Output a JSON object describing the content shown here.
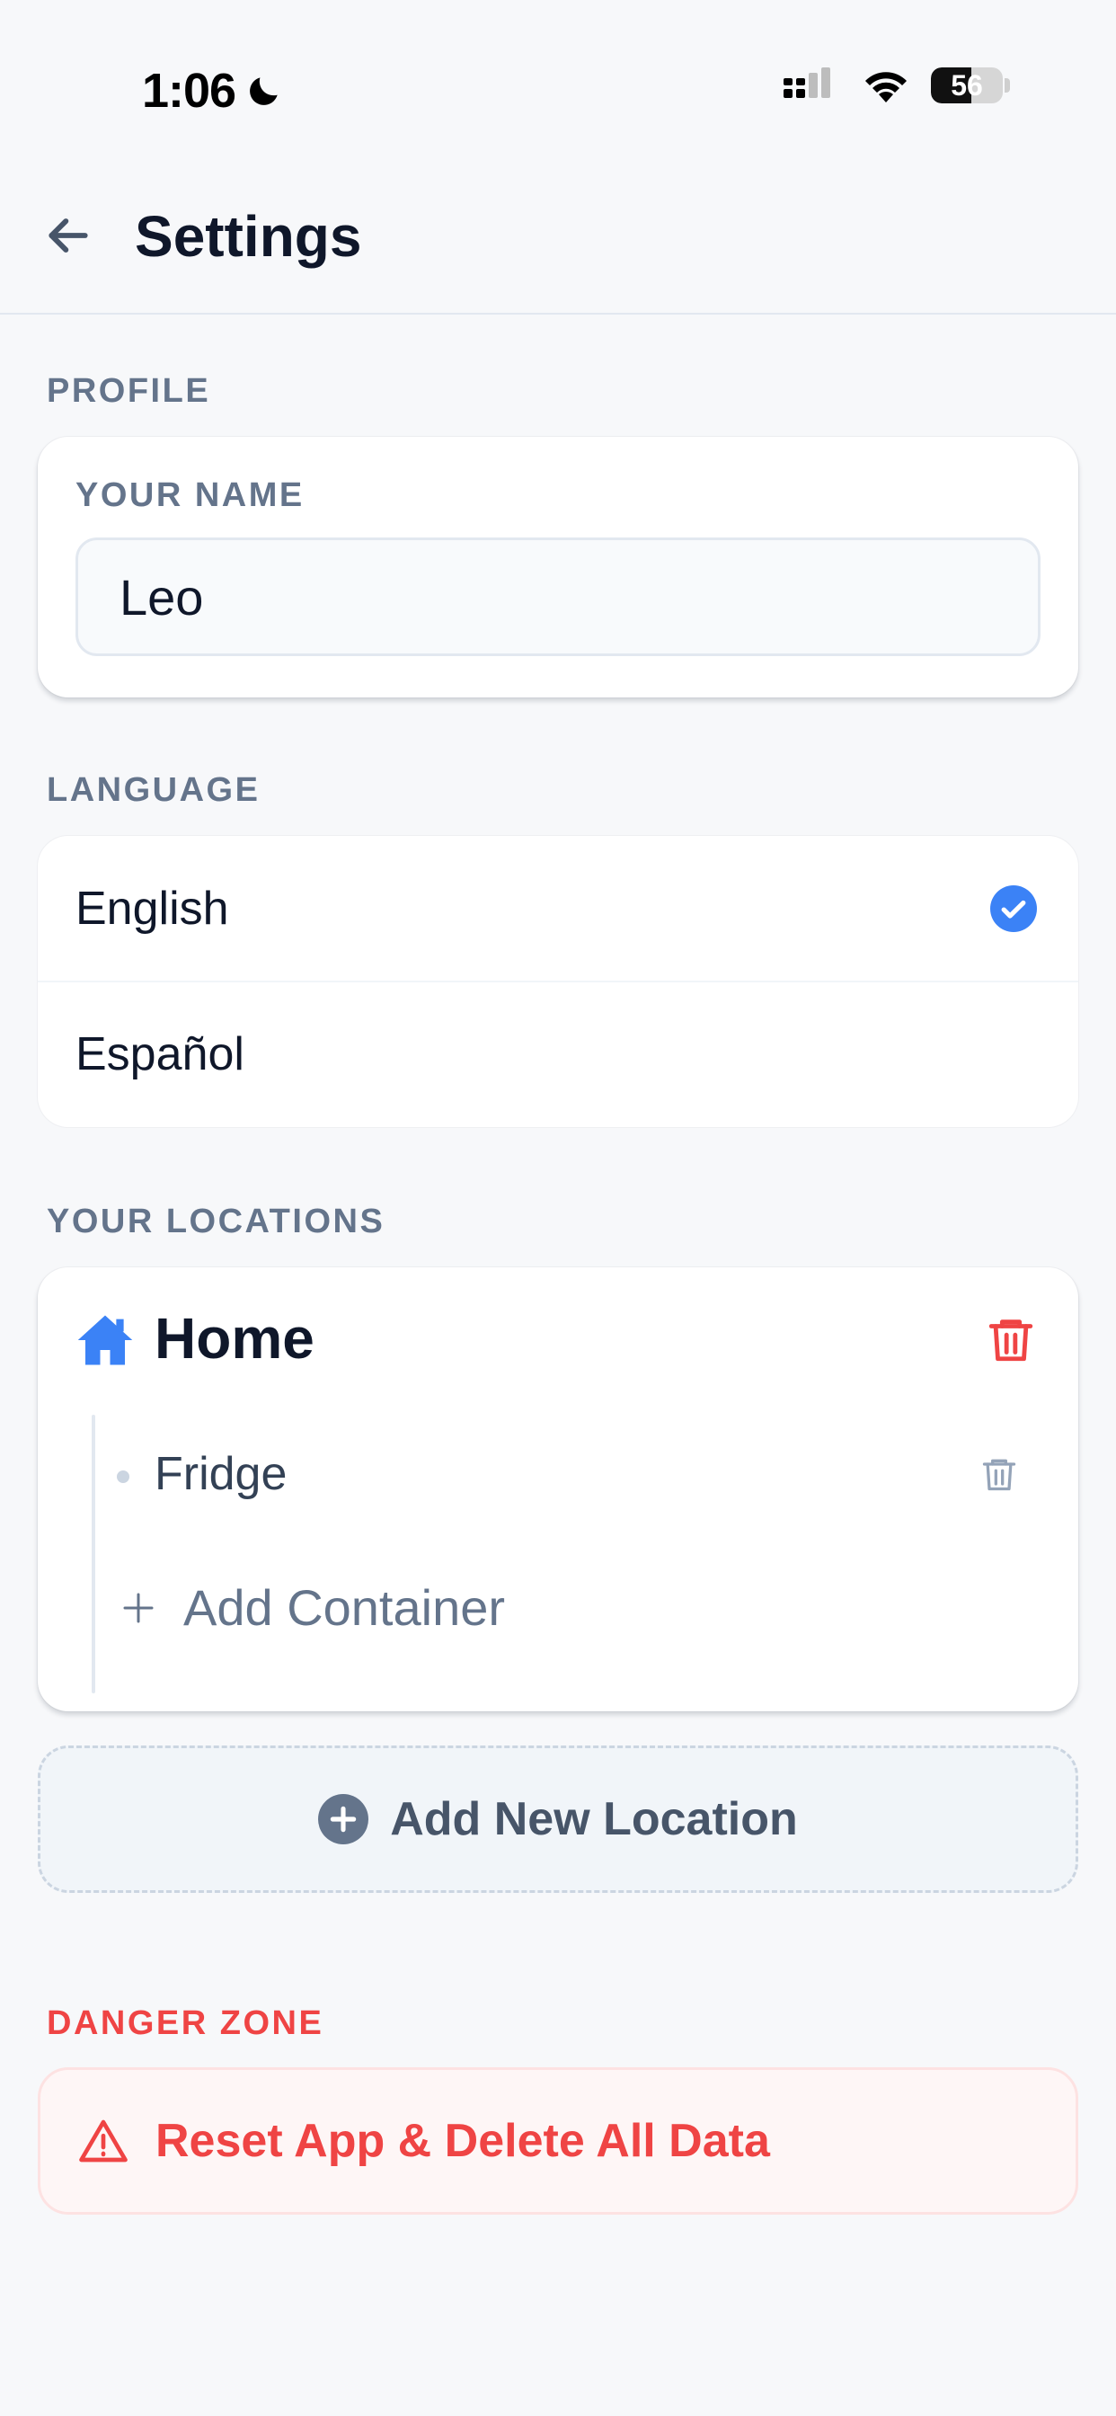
{
  "status_bar": {
    "time": "1:06",
    "battery": "56",
    "battery_level": 0.56
  },
  "header": {
    "title": "Settings"
  },
  "profile": {
    "section_label": "PROFILE",
    "name_label": "YOUR NAME",
    "name_value": "Leo"
  },
  "language": {
    "section_label": "LANGUAGE",
    "options": [
      {
        "label": "English",
        "selected": true
      },
      {
        "label": "Español",
        "selected": false
      }
    ]
  },
  "locations": {
    "section_label": "YOUR LOCATIONS",
    "items": [
      {
        "name": "Home",
        "icon": "home-icon",
        "containers": [
          "Fridge"
        ]
      }
    ],
    "add_container_label": "Add Container",
    "add_location_label": "Add New Location"
  },
  "danger_zone": {
    "section_label": "DANGER ZONE",
    "reset_label": "Reset App & Delete All Data"
  },
  "colors": {
    "accent": "#3b82f6",
    "danger": "#ef4444",
    "text_primary": "#0f172a",
    "text_muted": "#64748b",
    "background": "#f7f8fa"
  }
}
